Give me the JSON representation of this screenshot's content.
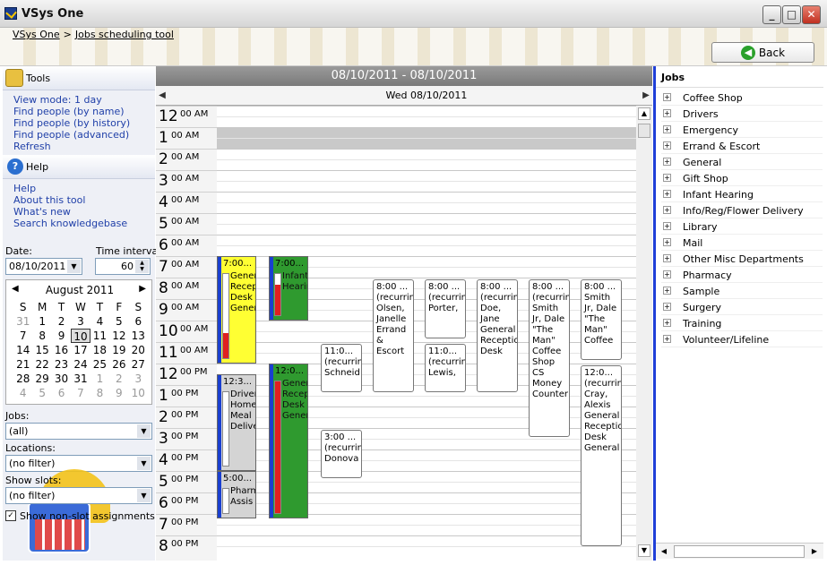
{
  "window": {
    "title": "VSys One",
    "controls": [
      "_",
      "□",
      "✕"
    ]
  },
  "breadcrumb": {
    "root": "VSys One",
    "sep": ">",
    "current": "Jobs scheduling tool"
  },
  "back_label": "Back",
  "tools": {
    "title": "Tools",
    "links": [
      "View mode: 1 day",
      "Find people (by name)",
      "Find people (by history)",
      "Find people (advanced)",
      "Refresh"
    ]
  },
  "help": {
    "title": "Help",
    "links": [
      "Help",
      "About this tool",
      "What's new",
      "Search knowledgebase"
    ]
  },
  "date": {
    "label": "Date:",
    "value": "08/10/2011"
  },
  "interval": {
    "label": "Time interval:",
    "value": "60"
  },
  "calendar": {
    "month": "August 2011",
    "weekdays": [
      "S",
      "M",
      "T",
      "W",
      "T",
      "F",
      "S"
    ],
    "weeks": [
      [
        "31",
        "1",
        "2",
        "3",
        "4",
        "5",
        "6"
      ],
      [
        "7",
        "8",
        "9",
        "10",
        "11",
        "12",
        "13"
      ],
      [
        "14",
        "15",
        "16",
        "17",
        "18",
        "19",
        "20"
      ],
      [
        "21",
        "22",
        "23",
        "24",
        "25",
        "26",
        "27"
      ],
      [
        "28",
        "29",
        "30",
        "31",
        "1",
        "2",
        "3"
      ],
      [
        "4",
        "5",
        "6",
        "7",
        "8",
        "9",
        "10"
      ]
    ],
    "selected": "10"
  },
  "filters": {
    "jobs": {
      "label": "Jobs:",
      "value": "(all)"
    },
    "locations": {
      "label": "Locations:",
      "value": "(no filter)"
    },
    "slots": {
      "label": "Show slots:",
      "value": "(no filter)"
    },
    "non_slot": {
      "label": "Show non-slot assignments",
      "checked": true
    }
  },
  "scheduler": {
    "range": "08/10/2011 - 08/10/2011",
    "day": "Wed 08/10/2011",
    "hours": [
      {
        "h": "12",
        "m": "00 AM"
      },
      {
        "h": "1",
        "m": "00 AM"
      },
      {
        "h": "2",
        "m": "00 AM"
      },
      {
        "h": "3",
        "m": "00 AM"
      },
      {
        "h": "4",
        "m": "00 AM"
      },
      {
        "h": "5",
        "m": "00 AM"
      },
      {
        "h": "6",
        "m": "00 AM"
      },
      {
        "h": "7",
        "m": "00 AM"
      },
      {
        "h": "8",
        "m": "00 AM"
      },
      {
        "h": "9",
        "m": "00 AM"
      },
      {
        "h": "10",
        "m": "00 AM"
      },
      {
        "h": "11",
        "m": "00 AM"
      },
      {
        "h": "12",
        "m": "00 PM"
      },
      {
        "h": "1",
        "m": "00 PM"
      },
      {
        "h": "2",
        "m": "00 PM"
      },
      {
        "h": "3",
        "m": "00 PM"
      },
      {
        "h": "4",
        "m": "00 PM"
      },
      {
        "h": "5",
        "m": "00 PM"
      },
      {
        "h": "6",
        "m": "00 PM"
      },
      {
        "h": "7",
        "m": "00 PM"
      },
      {
        "h": "8",
        "m": "00 PM"
      }
    ],
    "slots": [
      {
        "time": "7:00...",
        "text": "General Reception Desk General",
        "start": 7,
        "end": 12,
        "color": "#ffff33",
        "fill": 0.3
      },
      {
        "time": "12:3...",
        "text": "Drivers Home Meal Delivery",
        "start": 12.5,
        "end": 17,
        "color": "#d4d4d4",
        "fill": 0
      },
      {
        "time": "5:00...",
        "text": "Pharmacy Assis",
        "start": 17,
        "end": 19.2,
        "color": "#d4d4d4",
        "fill": 0
      },
      {
        "time": "7:00...",
        "text": "Infant Hearin",
        "start": 7,
        "end": 10,
        "color": "#2f9a2f",
        "fill": 0.75
      },
      {
        "time": "12:0...",
        "text": "General Reception Desk General",
        "start": 12,
        "end": 19.2,
        "color": "#2f9a2f",
        "fill": 1
      }
    ],
    "assignments": [
      {
        "time": "11:0...",
        "text": "(recurring) Schneid",
        "start": 11,
        "end": 13.4
      },
      {
        "time": "3:00 ...",
        "text": "(recurring) Donova",
        "start": 15,
        "end": 17.4
      },
      {
        "time": "8:00 ...",
        "text": "(recurring) Olsen, Janelle Errand & Escort",
        "start": 8,
        "end": 13.4
      },
      {
        "time": "8:00 ...",
        "text": "(recurring) Porter,",
        "start": 8,
        "end": 10.9
      },
      {
        "time": "11:0...",
        "text": "(recurring) Lewis,",
        "start": 11,
        "end": 13.4
      },
      {
        "time": "8:00 ...",
        "text": "(recurring) Doe, Jane General Reception Desk",
        "start": 8,
        "end": 13.4
      },
      {
        "time": "8:00 ...",
        "text": "(recurring) Smith Jr, Dale \"The Man\" Coffee Shop CS Money Counter",
        "start": 8,
        "end": 15.5
      },
      {
        "time": "8:00 ...",
        "text": "Smith Jr, Dale \"The Man\" Coffee",
        "start": 8,
        "end": 11.9
      },
      {
        "time": "12:0...",
        "text": "(recurring) Cray, Alexis General Reception Desk General",
        "start": 12,
        "end": 20.6
      }
    ]
  },
  "jobs": {
    "title": "Jobs",
    "items": [
      "Coffee Shop",
      "Drivers",
      "Emergency",
      "Errand & Escort",
      "General",
      "Gift Shop",
      "Infant Hearing",
      "Info/Reg/Flower Delivery",
      "Library",
      "Mail",
      "Other Misc Departments",
      "Pharmacy",
      "Sample",
      "Surgery",
      "Training",
      "Volunteer/Lifeline"
    ]
  }
}
